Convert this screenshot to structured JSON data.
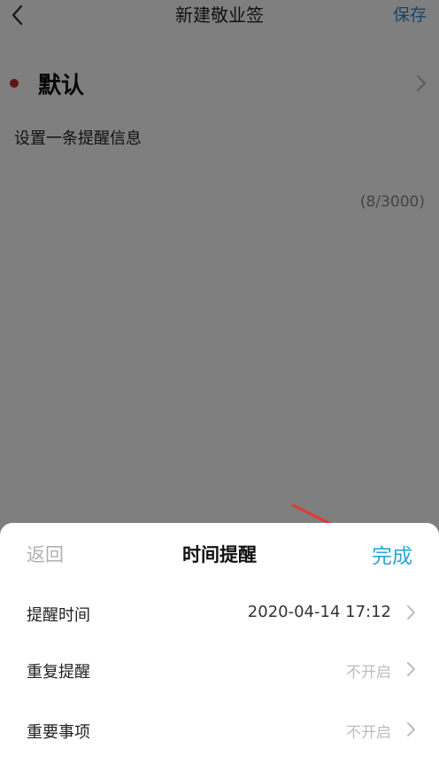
{
  "navbar": {
    "back_icon": "chevron-left-icon",
    "title": "新建敬业签",
    "save_label": "保存"
  },
  "category": {
    "label": "默认",
    "dot_color": "#c62828"
  },
  "note": {
    "text": "设置一条提醒信息",
    "char_count": "(8/3000)"
  },
  "sheet": {
    "back_label": "返回",
    "title": "时间提醒",
    "done_label": "完成",
    "rows": [
      {
        "label": "提醒时间",
        "value": "2020-04-14 17:12"
      },
      {
        "label": "重复提醒",
        "value": "不开启"
      },
      {
        "label": "重要事项",
        "value": "不开启"
      }
    ]
  },
  "colors": {
    "accent": "#2aa7d6",
    "save": "#2a8bd6",
    "annotation_arrow": "#e53935"
  }
}
